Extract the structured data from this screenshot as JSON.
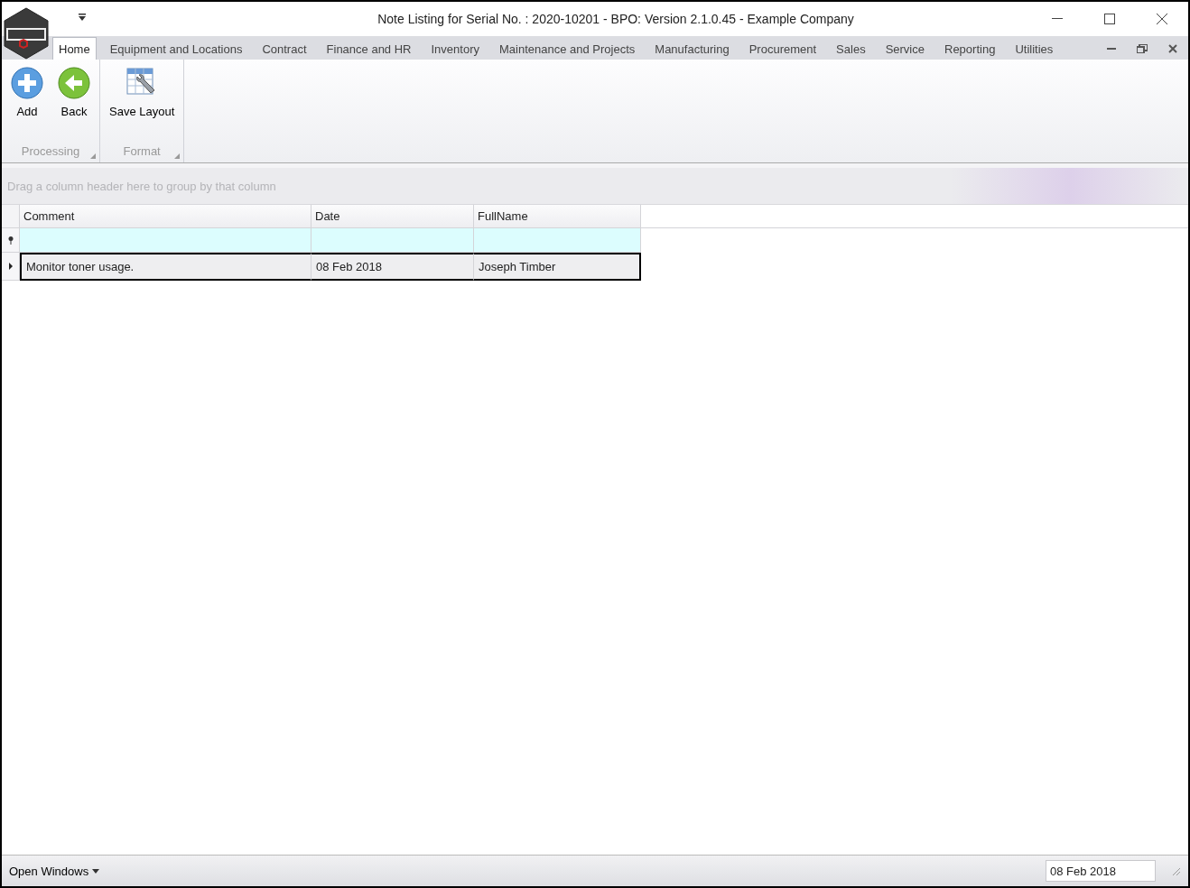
{
  "window": {
    "title": "Note Listing for Serial No. : 2020-10201 - BPO: Version 2.1.0.45 - Example Company"
  },
  "ribbon_tabs": [
    {
      "label": "Home",
      "selected": true
    },
    {
      "label": "Equipment and Locations",
      "selected": false
    },
    {
      "label": "Contract",
      "selected": false
    },
    {
      "label": "Finance and HR",
      "selected": false
    },
    {
      "label": "Inventory",
      "selected": false
    },
    {
      "label": "Maintenance and Projects",
      "selected": false
    },
    {
      "label": "Manufacturing",
      "selected": false
    },
    {
      "label": "Procurement",
      "selected": false
    },
    {
      "label": "Sales",
      "selected": false
    },
    {
      "label": "Service",
      "selected": false
    },
    {
      "label": "Reporting",
      "selected": false
    },
    {
      "label": "Utilities",
      "selected": false
    }
  ],
  "ribbon_groups": [
    {
      "label": "Processing",
      "buttons": [
        {
          "label": "Add",
          "kind": "add"
        },
        {
          "label": "Back",
          "kind": "back"
        }
      ]
    },
    {
      "label": "Format",
      "buttons": [
        {
          "label": "Save Layout",
          "kind": "layout"
        }
      ]
    }
  ],
  "grid": {
    "group_panel_hint": "Drag a column header here to group by that column",
    "columns": [
      "Comment",
      "Date",
      "FullName"
    ],
    "rows": [
      {
        "cells": [
          "Monitor toner usage.",
          "08 Feb 2018",
          "Joseph Timber"
        ],
        "selected": true
      }
    ]
  },
  "status_bar": {
    "open_windows": "Open Windows",
    "date": "08 Feb 2018"
  }
}
